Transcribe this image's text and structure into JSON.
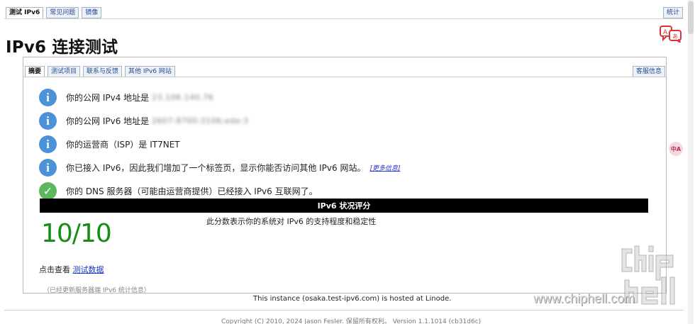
{
  "top_tabs": {
    "test_label": "测试 IPv6",
    "faq_label": "常见问题",
    "mirror_label": "镜像",
    "stats_label": "统计"
  },
  "page_title": "IPv6 连接测试",
  "inner_tabs": {
    "summary_label": "摘要",
    "test_items_label": "测试项目",
    "contact_label": "联系与反馈",
    "other_sites_label": "其他 IPv6 网站",
    "support_label": "客服信息"
  },
  "messages": {
    "ipv4_text": "你的公网 IPv4 地址是",
    "ipv4_value": "23.106.140.76",
    "ipv6_text": "你的公网 IPv6 地址是",
    "ipv6_value": "2607:8700:3106:ede:3",
    "isp_text": "你的运营商（ISP）是 IT7NET",
    "tab_notice_text": "你已接入 IPv6，因此我们增加了一个标签页，显示你能否访问其他 IPv6 网站。",
    "more_info_label": "[更多信息]",
    "dns_text": "你的 DNS 服务器（可能由运营商提供）已经接入 IPv6 互联网了。"
  },
  "score": {
    "bar_label": "IPv6 状况评分",
    "value": "10/10",
    "description": "此分数表示你的系统对 IPv6 的支持程度和稳定性"
  },
  "data_link": {
    "prefix": "点击查看",
    "label": "测试数据"
  },
  "server_note": "（已经更新服务器端 IPv6 统计信息）",
  "hosted_text": "This instance (osaka.test-ipv6.com) is hosted at Linode.",
  "copyright_text": "Copyright (C) 2010, 2024 Jason Fesler. 保留所有权利。 Version 1.1.1014 (cb31d6c)",
  "watermark": {
    "text": "www.chiphell.com"
  },
  "side_icon_text": "中A",
  "colors": {
    "score_green": "#168e16",
    "info_blue": "#4b92d8",
    "check_green": "#5cb85c",
    "link_blue": "#1736c7"
  }
}
